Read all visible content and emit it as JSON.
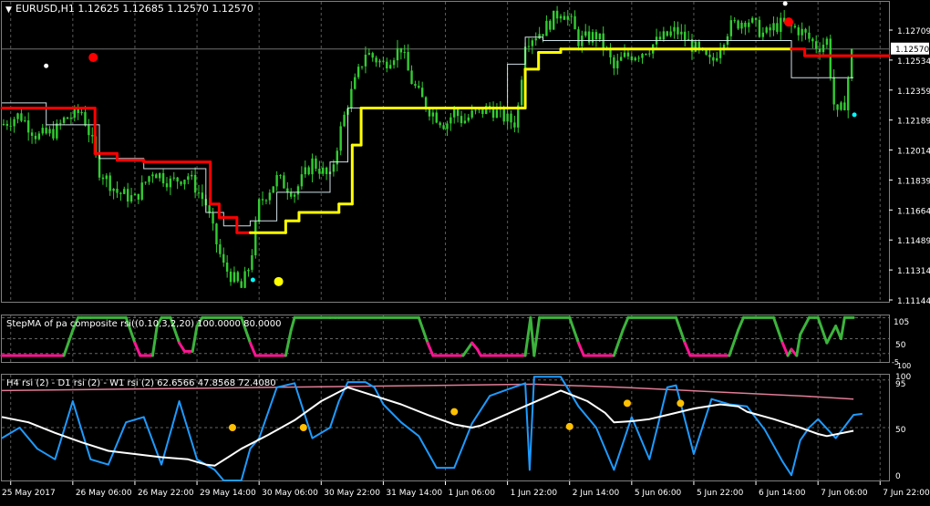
{
  "header": {
    "symbol_line": "EURUSD,H1  1.12625 1.12685 1.12570 1.12570"
  },
  "colors": {
    "background": "#000000",
    "candle": "#32cd32",
    "grid": "#7f7f7f",
    "step_red": "#ff0000",
    "step_yellow": "#ffff00",
    "osc_green": "#3cb43c",
    "osc_pink": "#ff1493",
    "rsi_h4": "#1e9bff",
    "rsi_d1": "#ffffff",
    "rsi_w1": "#e07c96",
    "signal_dot": "#ffc000",
    "label_text": "#ffffff"
  },
  "chart_data": [
    {
      "type": "candlestick",
      "title": "EURUSD,H1  1.12625 1.12685 1.12570 1.12570",
      "price_labels": [
        "1.12709",
        "1.12534",
        "1.12359",
        "1.12189",
        "1.12014",
        "1.11839",
        "1.11664",
        "1.11489",
        "1.11314",
        "1.11144"
      ],
      "ylim": [
        1.1107,
        1.1285
      ],
      "current_price": "1.12570",
      "x_labels": [
        "25 May 2017",
        "26 May 06:00",
        "26 May 22:00",
        "29 May 14:00",
        "30 May 06:00",
        "30 May 22:00",
        "31 May 14:00",
        "1 Jun 06:00",
        "1 Jun 22:00",
        "2 Jun 14:00",
        "5 Jun 06:00",
        "5 Jun 22:00",
        "6 Jun 14:00",
        "7 Jun 06:00",
        "7 Jun 22:00"
      ],
      "close_series": {
        "t": [
          0,
          2,
          4,
          6,
          7,
          9,
          10,
          11,
          13,
          15,
          17,
          19,
          21,
          23,
          24,
          25,
          27,
          28,
          29,
          31,
          33,
          35,
          37,
          38,
          39,
          41,
          43,
          45,
          46,
          47,
          48,
          50,
          51,
          52,
          53,
          55,
          57,
          58,
          59,
          61,
          63,
          64,
          65,
          67,
          68,
          69,
          70,
          72,
          73,
          74,
          76,
          78,
          80,
          81,
          82,
          84,
          86,
          87,
          88,
          90,
          92,
          93,
          94,
          95,
          96,
          97,
          98,
          100
        ],
        "v": [
          1.1212,
          1.1218,
          1.1205,
          1.1208,
          1.1215,
          1.122,
          1.1205,
          1.1185,
          1.1172,
          1.1168,
          1.1185,
          1.1178,
          1.1182,
          1.1165,
          1.1145,
          1.1128,
          1.1115,
          1.113,
          1.1165,
          1.118,
          1.1172,
          1.119,
          1.118,
          1.1205,
          1.1225,
          1.1255,
          1.1248,
          1.1258,
          1.124,
          1.123,
          1.1222,
          1.1212,
          1.122,
          1.1214,
          1.1218,
          1.1222,
          1.1215,
          1.1213,
          1.1262,
          1.1268,
          1.128,
          1.1275,
          1.1262,
          1.1265,
          1.1258,
          1.1245,
          1.1252,
          1.1255,
          1.1258,
          1.1262,
          1.1268,
          1.1258,
          1.1248,
          1.126,
          1.127,
          1.1275,
          1.1265,
          1.127,
          1.1272,
          1.1268,
          1.1258,
          1.1262,
          1.1215,
          1.1225,
          1.1262,
          1.1258,
          1.1262,
          1.1264
        ]
      },
      "step_line": {
        "t": [
          0,
          10.5,
          10.5,
          13,
          13,
          16,
          16,
          23.5,
          23.5,
          24.5,
          24.5,
          26.5,
          26.5,
          28,
          28,
          32,
          32,
          33.5,
          33.5,
          38,
          38,
          39.5,
          39.5,
          40.5,
          40.5,
          59,
          59,
          60.5,
          60.5,
          63,
          63,
          89,
          89,
          90.5,
          90.5,
          100
        ],
        "v": [
          1.1222,
          1.1222,
          1.1195,
          1.1195,
          1.1191,
          1.1191,
          1.119,
          1.119,
          1.1165,
          1.1165,
          1.1157,
          1.1157,
          1.1148,
          1.1148,
          1.1148,
          1.1148,
          1.1155,
          1.1155,
          1.116,
          1.116,
          1.1165,
          1.1165,
          1.12,
          1.12,
          1.1222,
          1.1222,
          1.1245,
          1.1245,
          1.1255,
          1.1255,
          1.1257,
          1.1257,
          1.1257,
          1.1257,
          1.1253,
          1.1253
        ],
        "color_change_index": [
          0,
          0,
          0,
          0,
          0,
          0,
          0,
          0,
          0,
          0,
          0,
          0,
          0,
          0,
          1,
          1,
          1,
          1,
          1,
          1,
          1,
          1,
          1,
          1,
          1,
          1,
          1,
          1,
          1,
          1,
          1,
          1,
          0,
          0,
          0,
          0
        ]
      },
      "thin_ma": {
        "t": [
          0,
          5,
          5,
          11,
          11,
          16,
          16,
          23,
          23,
          25,
          25,
          28,
          28,
          31,
          31,
          37,
          37,
          39,
          39,
          57,
          57,
          59,
          59,
          61,
          61,
          63,
          63,
          89,
          89,
          96
        ],
        "v": [
          1.1225,
          1.1225,
          1.1212,
          1.1212,
          1.1192,
          1.1192,
          1.1186,
          1.1186,
          1.116,
          1.116,
          1.1152,
          1.1152,
          1.1155,
          1.1155,
          1.1172,
          1.1172,
          1.119,
          1.119,
          1.1222,
          1.1222,
          1.1248,
          1.1248,
          1.1264,
          1.1264,
          1.1262,
          1.1262,
          1.1262,
          1.1262,
          1.124,
          1.124
        ]
      },
      "dots": [
        {
          "t": 5,
          "v": 1.1247,
          "color": "#ffffff",
          "r": 2.5
        },
        {
          "t": 10.3,
          "v": 1.1252,
          "color": "#ff0000",
          "r": 5
        },
        {
          "t": 28.3,
          "v": 1.112,
          "color": "#00ffff",
          "r": 2.5
        },
        {
          "t": 31.2,
          "v": 1.1119,
          "color": "#ffff00",
          "r": 5
        },
        {
          "t": 88.3,
          "v": 1.1284,
          "color": "#ffffff",
          "r": 2.5
        },
        {
          "t": 88.7,
          "v": 1.1273,
          "color": "#ff0000",
          "r": 5
        },
        {
          "t": 96.1,
          "v": 1.1218,
          "color": "#00ffff",
          "r": 2.5
        }
      ]
    },
    {
      "type": "line",
      "title": "StepMA of pa composite rsi((0.10,3,2,20) 100.0000 80.0000",
      "level_labels": [
        "105",
        "50",
        "-5",
        "100"
      ],
      "ylim": [
        -5,
        105
      ],
      "series": {
        "t": [
          0,
          7,
          8,
          8.6,
          9,
          10,
          14,
          15,
          15.6,
          16,
          17,
          17.5,
          18,
          18.6,
          19,
          20,
          20.6,
          21.5,
          22,
          22.6,
          23,
          27,
          28,
          28.6,
          29,
          32,
          32.6,
          33,
          36,
          37,
          37.6,
          38,
          47,
          48,
          48.6,
          49,
          52,
          53,
          53.6,
          54,
          58,
          59,
          59.6,
          60,
          60.6,
          61,
          64,
          65,
          65.6,
          66,
          69,
          70,
          70.6,
          71,
          76,
          77,
          77.6,
          78,
          82,
          83,
          83.6,
          84,
          87,
          88,
          88.6,
          89,
          89.6,
          90,
          91,
          91.6,
          92,
          93,
          94,
          94.6,
          95,
          96
        ],
        "v": [
          10,
          10,
          70,
          100,
          100,
          100,
          100,
          40,
          10,
          10,
          10,
          80,
          100,
          100,
          100,
          40,
          20,
          20,
          80,
          100,
          100,
          100,
          40,
          10,
          10,
          10,
          70,
          100,
          100,
          100,
          100,
          100,
          100,
          40,
          10,
          10,
          10,
          40,
          25,
          10,
          10,
          10,
          100,
          10,
          100,
          100,
          100,
          40,
          10,
          10,
          10,
          70,
          100,
          100,
          100,
          40,
          10,
          10,
          10,
          70,
          100,
          100,
          100,
          40,
          10,
          25,
          10,
          60,
          100,
          100,
          100,
          40,
          80,
          50,
          100,
          100
        ]
      },
      "high_level": 100,
      "low_level": 15
    },
    {
      "type": "line",
      "title": "H4 rsi (2) - D1 rsi (2) - W1 rsi (2) 62.6566 47.8568 72.4080",
      "level_labels": [
        "100",
        "95",
        "50",
        "0"
      ],
      "ylim": [
        0,
        100
      ],
      "series": [
        {
          "name": "H4 rsi (2)",
          "t": [
            0,
            2,
            4,
            6,
            8,
            10,
            12,
            14,
            16,
            18,
            20,
            22,
            24,
            25,
            27,
            28,
            29,
            31,
            33,
            35,
            37,
            38,
            39,
            40,
            41,
            42,
            43,
            45,
            47,
            49,
            51,
            53,
            55,
            57,
            59,
            59.5,
            60,
            61,
            62,
            63,
            65,
            67,
            69,
            71,
            73,
            75,
            76,
            78,
            80,
            82,
            84,
            86,
            88,
            89,
            90,
            91,
            92,
            94,
            96,
            97
          ],
          "v": [
            40,
            50,
            30,
            20,
            75,
            20,
            15,
            55,
            60,
            15,
            75,
            20,
            10,
            0,
            0,
            30,
            40,
            88,
            92,
            40,
            50,
            75,
            93,
            93,
            93,
            88,
            72,
            55,
            42,
            12,
            12,
            54,
            80,
            86,
            92,
            10,
            98,
            98,
            98,
            98,
            70,
            50,
            10,
            60,
            20,
            88,
            90,
            25,
            77,
            72,
            70,
            48,
            18,
            5,
            38,
            50,
            58,
            40,
            62,
            63
          ]
        },
        {
          "name": "D1 rsi (2)",
          "t": [
            0,
            3,
            6,
            9,
            12,
            15,
            18,
            21,
            23,
            24,
            27,
            30,
            33,
            36,
            39,
            42,
            45,
            48,
            51,
            53,
            54,
            57,
            60,
            63,
            66,
            68,
            69,
            71,
            73,
            75,
            78,
            81,
            83,
            84,
            87,
            90,
            92,
            93,
            96
          ],
          "v": [
            60,
            55,
            45,
            36,
            28,
            25,
            22,
            20,
            15,
            14,
            30,
            43,
            57,
            75,
            88,
            80,
            72,
            62,
            53,
            50,
            52,
            63,
            74,
            85,
            75,
            64,
            55,
            56,
            58,
            62,
            68,
            72,
            70,
            65,
            58,
            50,
            44,
            42,
            47
          ]
        },
        {
          "name": "W1 rsi (2)",
          "t": [
            0,
            10,
            20,
            30,
            40,
            50,
            60,
            70,
            80,
            90,
            96
          ],
          "v": [
            85,
            86,
            87,
            88,
            89,
            90,
            91,
            88,
            84,
            80,
            77
          ]
        }
      ],
      "signal_dots": {
        "t": [
          26,
          34,
          51,
          64,
          70.5,
          76.5
        ],
        "v": [
          50,
          50,
          65,
          51,
          73,
          73
        ]
      }
    }
  ]
}
